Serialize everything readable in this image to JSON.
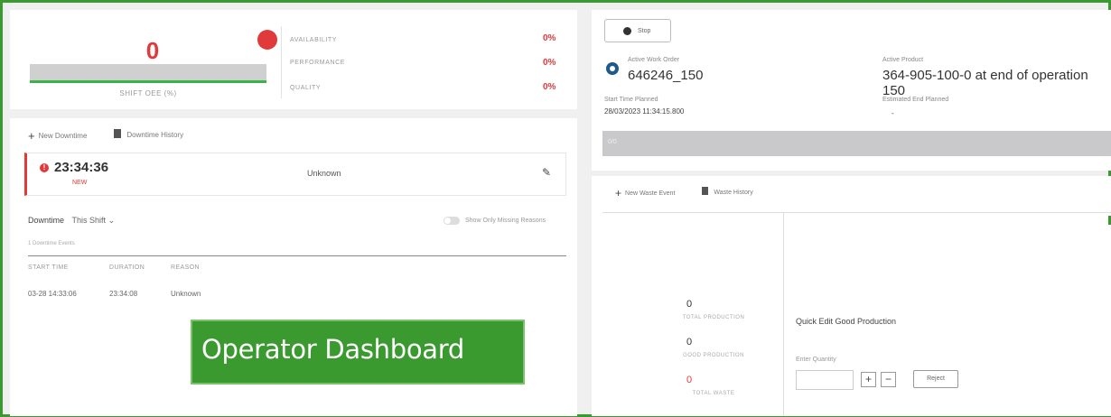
{
  "oee": {
    "value": "0",
    "shift_label": "SHIFT OEE (%)",
    "metrics": [
      {
        "name": "AVAILABILITY",
        "value": "0%"
      },
      {
        "name": "PERFORMANCE",
        "value": "0%"
      },
      {
        "name": "QUALITY",
        "value": "0%"
      }
    ]
  },
  "downtime": {
    "new_downtime": "New Downtime",
    "history": "Downtime History",
    "event": {
      "time": "23:34:36",
      "sub": "NEW",
      "reason": "Unknown"
    },
    "heading": "Downtime",
    "shift_select": "This Shift",
    "toggle_label": "Show Only Missing Reasons",
    "count_label": "1 Downtime Events",
    "columns": [
      "START TIME",
      "DURATION",
      "REASON"
    ],
    "row": [
      "03-28 14:33:06",
      "23:34:08",
      "Unknown"
    ]
  },
  "overlay_label": "Operator Dashboard",
  "work_order": {
    "stop_label": "Stop",
    "active_wo_label": "Active Work Order",
    "active_wo_value": "646246_150",
    "active_product_label": "Active Product",
    "active_product_value": "364-905-100-0 at end of operation 150",
    "start_label": "Start Time Planned",
    "start_value": "28/03/2023 11:34:15.800",
    "end_label": "Estimated End Planned",
    "end_value": "-",
    "progress_label": "0/0"
  },
  "waste": {
    "new_waste": "New Waste Event",
    "history": "Waste History",
    "total_production": {
      "value": "0",
      "label": "TOTAL PRODUCTION"
    },
    "good_production": {
      "value": "0",
      "label": "GOOD PRODUCTION"
    },
    "total_waste": {
      "value": "0",
      "label": "TOTAL WASTE"
    },
    "quick_edit_title": "Quick Edit Good Production",
    "enter_quantity": "Enter Quantity",
    "plus": "+",
    "minus": "−",
    "reject": "Reject"
  }
}
